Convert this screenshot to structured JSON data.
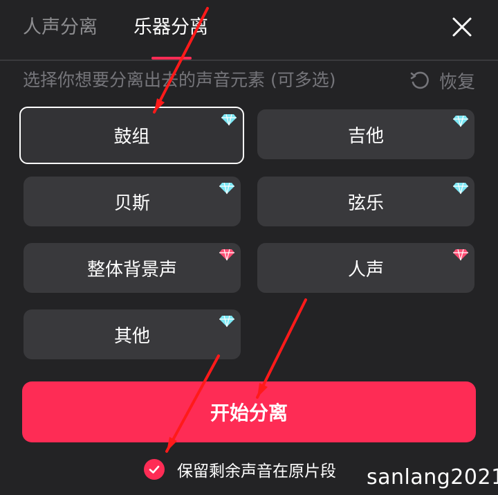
{
  "tabs": [
    {
      "label": "人声分离",
      "active": false
    },
    {
      "label": "乐器分离",
      "active": true
    }
  ],
  "close_icon": "close-icon",
  "hint": "选择你想要分离出去的声音元素 (可多选)",
  "reset_label": "恢复",
  "options": [
    {
      "label": "鼓组",
      "selected": true,
      "gem": "diamond-blue"
    },
    {
      "label": "吉他",
      "selected": false,
      "gem": "diamond-blue"
    },
    {
      "label": "贝斯",
      "selected": false,
      "gem": "diamond-blue"
    },
    {
      "label": "弦乐",
      "selected": false,
      "gem": "diamond-blue"
    },
    {
      "label": "整体背景声",
      "selected": false,
      "gem": "diamond-pink"
    },
    {
      "label": "人声",
      "selected": false,
      "gem": "diamond-pink"
    },
    {
      "label": "其他",
      "selected": false,
      "gem": "diamond-blue"
    }
  ],
  "start_button": "开始分离",
  "keep_checkbox": {
    "label": "保留剩余声音在原片段",
    "checked": true
  },
  "watermark": "sanlang2021",
  "colors": {
    "accent": "#fe2c55",
    "background": "#232325",
    "option_bg": "#39393c",
    "gem_blue": "#7de8f5",
    "gem_pink": "#ff4d73",
    "annotation_arrow": "#ff1a1a"
  }
}
